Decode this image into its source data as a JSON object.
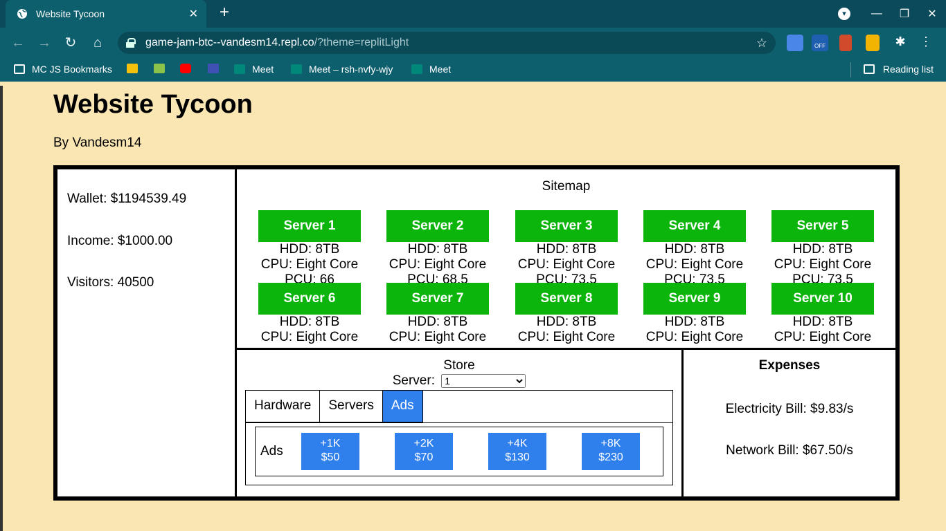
{
  "browser": {
    "tab_title": "Website Tycoon",
    "url_host": "game-jam-btc--vandesm14.repl.co",
    "url_rest": "/?theme=replitLight",
    "bookmarks": [
      "MC JS Bookmarks",
      "Meet",
      "Meet – rsh-nvfy-wjy",
      "Meet"
    ],
    "reading_list": "Reading list",
    "ext_badge": "OFF"
  },
  "page": {
    "title": "Website Tycoon",
    "byline": "By Vandesm14"
  },
  "stats": {
    "wallet": "Wallet: $1194539.49",
    "income": "Income: $1000.00",
    "visitors": "Visitors: 40500"
  },
  "sitemap": {
    "title": "Sitemap",
    "servers": [
      {
        "name": "Server 1",
        "hdd": "HDD: 8TB",
        "cpu": "CPU: Eight Core",
        "pcu": "PCU: 66"
      },
      {
        "name": "Server 2",
        "hdd": "HDD: 8TB",
        "cpu": "CPU: Eight Core",
        "pcu": "PCU: 68.5"
      },
      {
        "name": "Server 3",
        "hdd": "HDD: 8TB",
        "cpu": "CPU: Eight Core",
        "pcu": "PCU: 73.5"
      },
      {
        "name": "Server 4",
        "hdd": "HDD: 8TB",
        "cpu": "CPU: Eight Core",
        "pcu": "PCU: 73.5"
      },
      {
        "name": "Server 5",
        "hdd": "HDD: 8TB",
        "cpu": "CPU: Eight Core",
        "pcu": "PCU: 73.5"
      },
      {
        "name": "Server 6",
        "hdd": "HDD: 8TB",
        "cpu": "CPU: Eight Core",
        "pcu": ""
      },
      {
        "name": "Server 7",
        "hdd": "HDD: 8TB",
        "cpu": "CPU: Eight Core",
        "pcu": ""
      },
      {
        "name": "Server 8",
        "hdd": "HDD: 8TB",
        "cpu": "CPU: Eight Core",
        "pcu": ""
      },
      {
        "name": "Server 9",
        "hdd": "HDD: 8TB",
        "cpu": "CPU: Eight Core",
        "pcu": ""
      },
      {
        "name": "Server 10",
        "hdd": "HDD: 8TB",
        "cpu": "CPU: Eight Core",
        "pcu": ""
      }
    ]
  },
  "store": {
    "title": "Store",
    "server_label": "Server:",
    "server_selected": "1",
    "tabs": [
      "Hardware",
      "Servers",
      "Ads"
    ],
    "active_tab": "Ads",
    "ads_label": "Ads",
    "ads": [
      {
        "line1": "+1K",
        "line2": "$50"
      },
      {
        "line1": "+2K",
        "line2": "$70"
      },
      {
        "line1": "+4K",
        "line2": "$130"
      },
      {
        "line1": "+8K",
        "line2": "$230"
      }
    ]
  },
  "expenses": {
    "title": "Expenses",
    "electricity": "Electricity Bill: $9.83/s",
    "network": "Network Bill: $67.50/s"
  },
  "colors": {
    "page_bg": "#f9e6b3",
    "server_green": "#0bb50b",
    "accent_blue": "#2f80ed",
    "chrome_teal": "#0e5f6e"
  }
}
